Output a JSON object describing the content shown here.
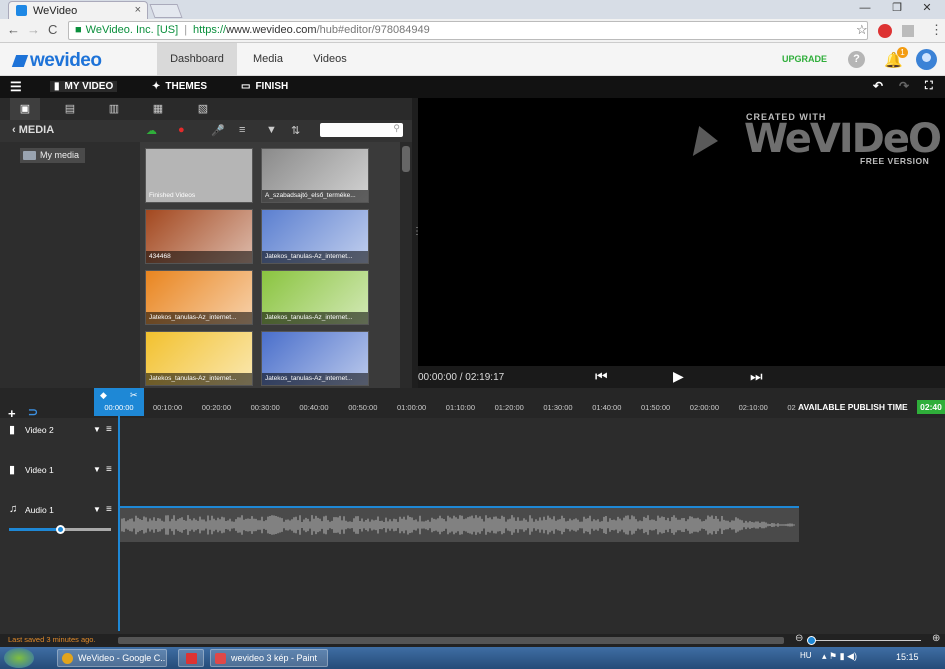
{
  "browser": {
    "tab_title": "WeVideo",
    "tab_close": "×",
    "window_buttons": [
      "—",
      "❐",
      "✕"
    ],
    "nav_back": "←",
    "nav_forward": "→",
    "nav_reload": "C",
    "org": "WeVideo. Inc. [US]",
    "url_scheme": "https://",
    "url_host": "www.wevideo.com",
    "url_path": "/hub#editor/978084949",
    "star": "☆",
    "menu": "⋮"
  },
  "topnav": {
    "logo": "wevideo",
    "tabs": [
      "Dashboard",
      "Media",
      "Videos"
    ],
    "active_tab": "Dashboard",
    "upgrade": "UPGRADE",
    "help": "?",
    "notifications": "1"
  },
  "editor_header": {
    "my_video": "MY VIDEO",
    "themes": "THEMES",
    "finish": "FINISH"
  },
  "media": {
    "title": "MEDIA",
    "folder": "My media",
    "items": [
      {
        "caption": "Finished Videos",
        "color": "#a9a9a9"
      },
      {
        "caption": "A_szabadsajtó_első_terméke...",
        "color": "#8a8a8a"
      },
      {
        "caption": "434468",
        "color": "#a3481f"
      },
      {
        "caption": "Jatekos_tanulas-Az_internet...",
        "color": "#5b7fd0"
      },
      {
        "caption": "Jatekos_tanulas-Az_internet...",
        "color": "#e9851f"
      },
      {
        "caption": "Jatekos_tanulas-Az_internet...",
        "color": "#8ac43f"
      },
      {
        "caption": "Jatekos_tanulas-Az_internet...",
        "color": "#f2c12e"
      },
      {
        "caption": "Jatekos_tanulas-Az_internet...",
        "color": "#4a6fcb"
      }
    ]
  },
  "preview": {
    "created_with": "CREATED WITH",
    "brand": "WeVIDeO",
    "free_version": "FREE VERSION",
    "timecode": "00:00:00 / 02:19:17"
  },
  "timeline": {
    "playhead": "00:00:00",
    "ticks": [
      "00:10:00",
      "00:20:00",
      "00:30:00",
      "00:40:00",
      "00:50:00",
      "01:00:00",
      "01:10:00",
      "01:20:00",
      "01:30:00",
      "01:40:00",
      "01:50:00",
      "02:00:00",
      "02:10:00",
      "02"
    ],
    "publish_label": "AVAILABLE PUBLISH TIME",
    "publish_value": "02:40",
    "tracks": [
      {
        "name": "Video 2"
      },
      {
        "name": "Video 1"
      },
      {
        "name": "Audio 1"
      }
    ],
    "volume_fraction": 0.5
  },
  "status": {
    "last_saved": "Last saved 3 minutes ago."
  },
  "taskbar": {
    "items": [
      "WeVideo - Google C...",
      "",
      "wevideo 3 kép - Paint"
    ],
    "lang": "HU",
    "clock": "15:15"
  }
}
